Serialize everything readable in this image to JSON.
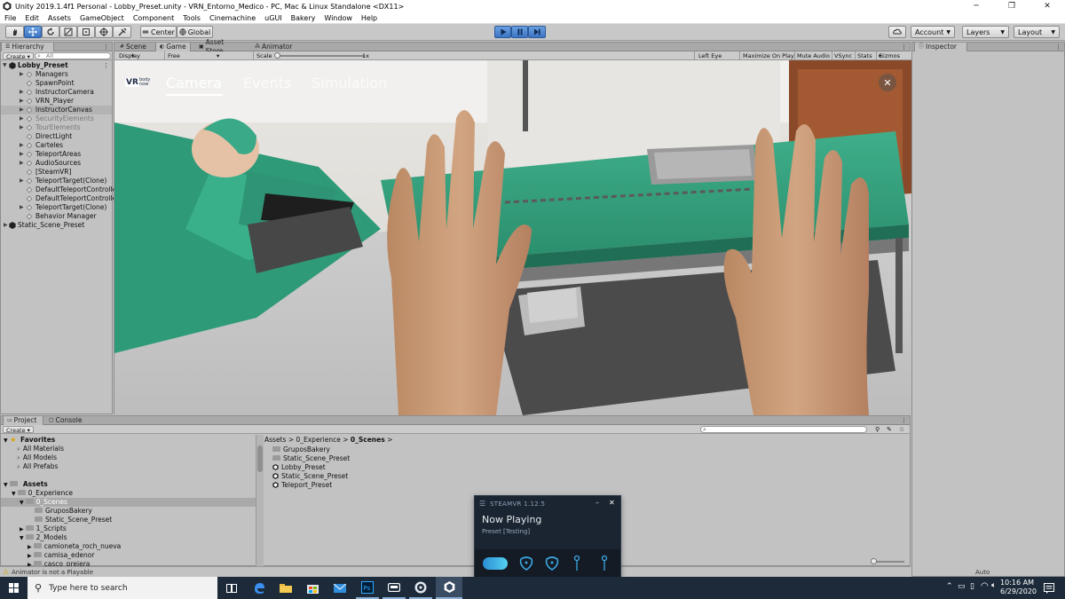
{
  "window": {
    "title": "Unity 2019.1.4f1 Personal - Lobby_Preset.unity - VRN_Entorno_Medico - PC, Mac & Linux Standalone <DX11>"
  },
  "menu": [
    "File",
    "Edit",
    "Assets",
    "GameObject",
    "Component",
    "Tools",
    "Cinemachine",
    "uGUI",
    "Bakery",
    "Window",
    "Help"
  ],
  "toolbar": {
    "pivot_label": "Center",
    "space_label": "Global",
    "account_label": "Account",
    "layers_label": "Layers",
    "layout_label": "Layout"
  },
  "hierarchy": {
    "tab_label": "Hierarchy",
    "create_label": "Create",
    "search_placeholder": "All",
    "scene_root": "Lobby_Preset",
    "items": [
      {
        "label": "Managers",
        "expandable": true,
        "dim": false
      },
      {
        "label": "SpawnPoint",
        "expandable": false,
        "dim": false
      },
      {
        "label": "InstructorCamera",
        "expandable": true,
        "dim": false
      },
      {
        "label": "VRN_Player",
        "expandable": true,
        "dim": false
      },
      {
        "label": "InstructorCanvas",
        "expandable": true,
        "dim": false
      },
      {
        "label": "SecurityElements",
        "expandable": true,
        "dim": true
      },
      {
        "label": "TourElements",
        "expandable": true,
        "dim": true
      },
      {
        "label": "DirectLight",
        "expandable": false,
        "dim": false
      },
      {
        "label": "Carteles",
        "expandable": true,
        "dim": false
      },
      {
        "label": "TeleportAreas",
        "expandable": true,
        "dim": false
      },
      {
        "label": "AudioSources",
        "expandable": true,
        "dim": false
      },
      {
        "label": "[SteamVR]",
        "expandable": false,
        "dim": false
      },
      {
        "label": "TeleportTarget(Clone)",
        "expandable": true,
        "dim": false
      },
      {
        "label": "DefaultTeleportControlle",
        "expandable": false,
        "dim": false
      },
      {
        "label": "DefaultTeleportControlle",
        "expandable": false,
        "dim": false
      },
      {
        "label": "TeleportTarget(Clone)",
        "expandable": true,
        "dim": false
      },
      {
        "label": "Behavior Manager",
        "expandable": false,
        "dim": false
      }
    ],
    "second_scene": "Static_Scene_Preset"
  },
  "center_tabs": [
    {
      "label": "Scene",
      "selected": false
    },
    {
      "label": "Game",
      "selected": true
    },
    {
      "label": "Asset Store",
      "selected": false
    },
    {
      "label": "Animator",
      "selected": false
    }
  ],
  "game_bar": {
    "display": "Display 1",
    "aspect": "Free Aspect",
    "scale_label": "Scale",
    "scale_value": "1x",
    "left_eye": "Left Eye",
    "maximize": "Maximize On Play",
    "mute": "Mute Audio",
    "vsync": "VSync",
    "stats": "Stats",
    "gizmos": "Gizmos"
  },
  "game_ui": {
    "logo_text": "VR",
    "logo_sub": "body now",
    "tabs": [
      {
        "label": "Camera",
        "active": true
      },
      {
        "label": "Events",
        "active": false
      },
      {
        "label": "Simulation",
        "active": false
      }
    ]
  },
  "inspector": {
    "tab_label": "Inspector"
  },
  "project": {
    "tab_label": "Project",
    "console_label": "Console",
    "create_label": "Create",
    "favorites_label": "Favorites",
    "favorites": [
      "All Materials",
      "All Models",
      "All Prefabs"
    ],
    "assets_label": "Assets",
    "tree": [
      {
        "label": "0_Experience",
        "level": 1
      },
      {
        "label": "0_Scenes",
        "level": 2,
        "selected": true
      },
      {
        "label": "GruposBakery",
        "level": 3
      },
      {
        "label": "Static_Scene_Preset",
        "level": 3
      },
      {
        "label": "1_Scripts",
        "level": 2
      },
      {
        "label": "2_Models",
        "level": 2
      },
      {
        "label": "camioneta_roch_nueva",
        "level": 3
      },
      {
        "label": "camisa_edenor",
        "level": 3
      },
      {
        "label": "casco_prejera",
        "level": 3
      }
    ],
    "breadcrumb": [
      "Assets",
      "0_Experience",
      "0_Scenes"
    ],
    "files": [
      {
        "label": "GruposBakery",
        "type": "folder"
      },
      {
        "label": "Static_Scene_Preset",
        "type": "folder"
      },
      {
        "label": "Lobby_Preset",
        "type": "scene"
      },
      {
        "label": "Static_Scene_Preset",
        "type": "scene"
      },
      {
        "label": "Teleport_Preset",
        "type": "scene"
      }
    ]
  },
  "status": {
    "message": "Animator is not a Playable",
    "right": "Auto Generate Lighting Off"
  },
  "steamvr": {
    "title": "STEAMVR 1.12.5",
    "now_playing": "Now Playing",
    "app": "Preset [Testing]"
  },
  "taskbar": {
    "search_placeholder": "Type here to search",
    "time": "10:16 AM",
    "date": "6/29/2020"
  }
}
